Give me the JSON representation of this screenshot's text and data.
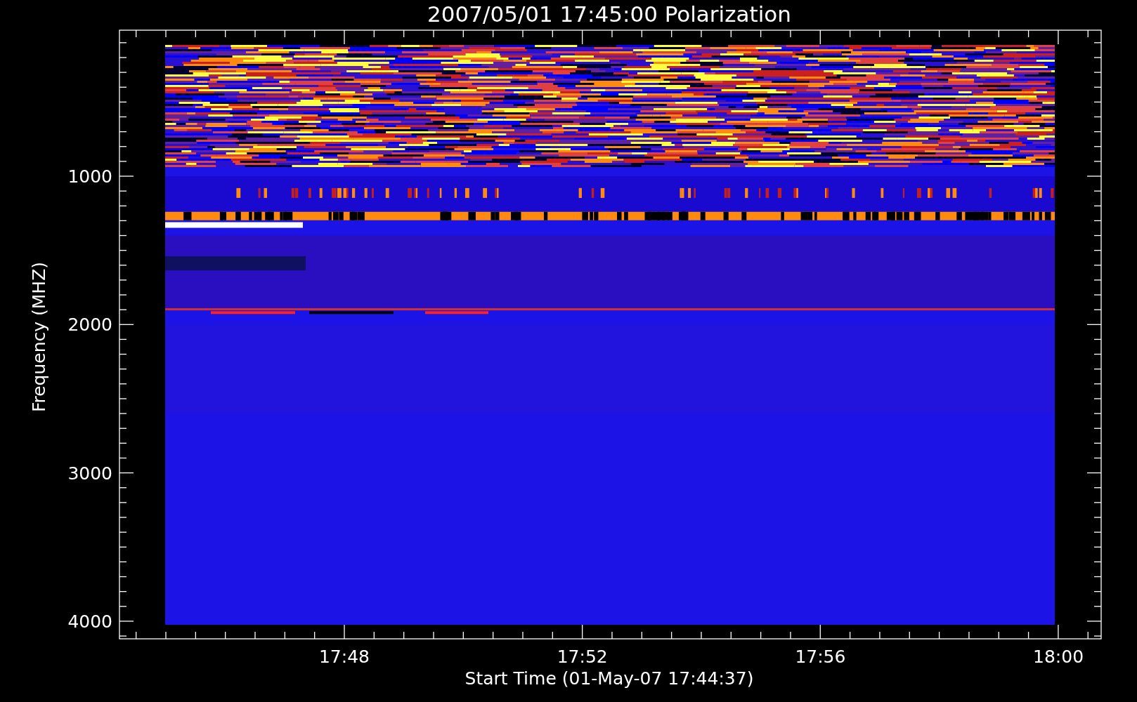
{
  "title": "2007/05/01 17:45:00 Polarization",
  "y_axis": {
    "label": "Frequency (MHZ)",
    "ticks": [
      "1000",
      "2000",
      "3000",
      "4000"
    ]
  },
  "x_axis": {
    "label": "Start Time (01-May-07 17:44:37)",
    "ticks": [
      "17:48",
      "17:52",
      "17:56",
      "18:00"
    ]
  }
}
